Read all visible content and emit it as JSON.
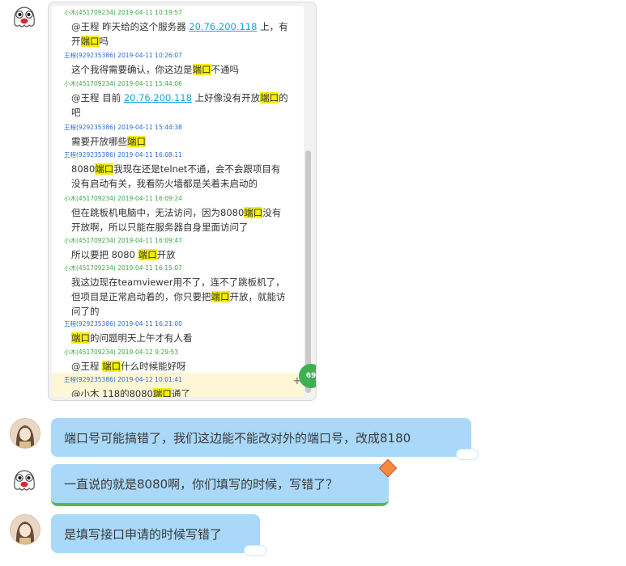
{
  "record": {
    "messages": [
      {
        "sender": "小木(451709234)",
        "time": "2019-04-11 10:19:57",
        "color": "green",
        "parts": [
          [
            "@王程 昨天给的这个服务器 ",
            ""
          ],
          [
            "20.76.200.118",
            "ip"
          ],
          [
            " 上，有开",
            ""
          ],
          [
            "端口",
            "hl"
          ],
          [
            "吗",
            ""
          ]
        ]
      },
      {
        "sender": "王程(929235386)",
        "time": "2019-04-11 10:26:07",
        "color": "blue",
        "parts": [
          [
            "这个我得需要确认，你这边是",
            ""
          ],
          [
            "端口",
            "hl"
          ],
          [
            "不通吗",
            ""
          ]
        ]
      },
      {
        "sender": "小木(451709234)",
        "time": "2019-04-11 15:44:06",
        "color": "green",
        "parts": [
          [
            "@王程 目前 ",
            ""
          ],
          [
            "20.76.200.118",
            "ip"
          ],
          [
            " 上好像没有开放",
            ""
          ],
          [
            "端口",
            "hl"
          ],
          [
            "的吧",
            ""
          ]
        ]
      },
      {
        "sender": "王程(929235386)",
        "time": "2019-04-11 15:44:38",
        "color": "blue",
        "parts": [
          [
            "需要开放哪些",
            ""
          ],
          [
            "端口",
            "hl"
          ]
        ]
      },
      {
        "sender": "王程(929235386)",
        "time": "2019-04-11 16:08:11",
        "color": "blue",
        "parts": [
          [
            "8080",
            ""
          ],
          [
            "端口",
            "hl"
          ],
          [
            "我现在还是telnet不通，会不会跟项目有没有启动有关，我看防火墙都是关着未启动的",
            ""
          ]
        ]
      },
      {
        "sender": "小木(451709234)",
        "time": "2019-04-11 16:09:24",
        "color": "green",
        "parts": [
          [
            "但在跳板机电脑中，无法访问，因为8080",
            ""
          ],
          [
            "端口",
            "hl"
          ],
          [
            "没有开放啊，所以只能在服务器自身里面访问了",
            ""
          ]
        ]
      },
      {
        "sender": "小木(451709234)",
        "time": "2019-04-11 16:09:47",
        "color": "green",
        "parts": [
          [
            "所以要把 8080 ",
            ""
          ],
          [
            "端口",
            "hl"
          ],
          [
            "开放",
            ""
          ]
        ]
      },
      {
        "sender": "小木(451709234)",
        "time": "2019-04-11 16:15:07",
        "color": "green",
        "parts": [
          [
            "我这边现在teamviewer用不了，连不了跳板机了，但项目是正常启动着的，你只要把",
            ""
          ],
          [
            "端口",
            "hl"
          ],
          [
            "开放，就能访问了的",
            ""
          ]
        ]
      },
      {
        "sender": "王程(929235386)",
        "time": "2019-04-11 16:21:00",
        "color": "blue",
        "parts": [
          [
            "端口",
            "hl"
          ],
          [
            "的问题明天上午才有人看",
            ""
          ]
        ]
      },
      {
        "sender": "小木(451709234)",
        "time": "2019-04-12 9:29:53",
        "color": "green",
        "parts": [
          [
            "@王程 ",
            ""
          ],
          [
            "端口",
            "hl"
          ],
          [
            "什么时候能好呀",
            ""
          ]
        ]
      },
      {
        "sender": "王程(929235386)",
        "time": "2019-04-12 10:01:41",
        "color": "blue",
        "parts": [
          [
            "@小木 118的8080",
            ""
          ],
          [
            "端口",
            "hl"
          ],
          [
            "通了",
            ""
          ]
        ]
      }
    ],
    "fab_count": "69"
  },
  "bubbles": [
    {
      "text": "端口号可能搞错了，我们这边能不能改对外的端口号，改成8180"
    },
    {
      "text": "一直说的就是8080啊，你们填写的时候，写错了？"
    },
    {
      "text": "是填写接口申请的时候写错了"
    }
  ],
  "colors": {
    "bubble": "#a9d8f8",
    "highlight": "#f6f000",
    "link": "#1ea0d8",
    "sender_green": "#3aa845",
    "sender_blue": "#2a6bd1"
  }
}
